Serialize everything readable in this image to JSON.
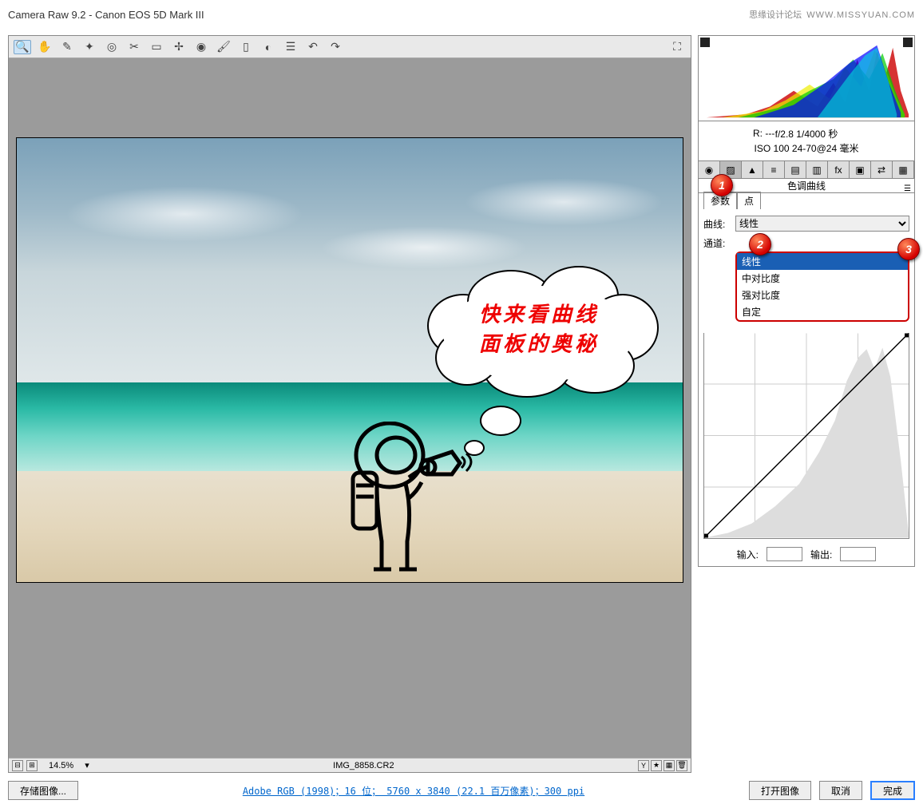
{
  "titlebar": {
    "app": "Camera Raw 9.2  -  Canon EOS 5D Mark III",
    "watermark_text": "思缘设计论坛",
    "watermark_url": "WWW.MISSYUAN.COM"
  },
  "toolbar": {
    "tools": [
      "zoom",
      "hand",
      "eyedropper",
      "sampler",
      "target",
      "crop",
      "straighten",
      "spot",
      "redeye",
      "brush",
      "grad",
      "radial",
      "prefs",
      "rotate-ccw",
      "rotate-cw"
    ],
    "fullscreen": "⛶"
  },
  "canvas": {
    "speech_line1": "快来看曲线",
    "speech_line2": "面板的奥秘"
  },
  "statusbar": {
    "zoom": "14.5%",
    "filename": "IMG_8858.CR2"
  },
  "exif": {
    "r_label": "R:  ---",
    "line1": "f/2.8    1/4000 秒",
    "line2": "ISO 100    24-70@24 毫米"
  },
  "panel": {
    "title": "色调曲线",
    "subtabs": {
      "parametric": "参数",
      "point": "点"
    },
    "curve_label": "曲线:",
    "curve_value": "线性",
    "channel_label": "通道:",
    "dropdown": [
      "线性",
      "中对比度",
      "强对比度",
      "自定"
    ],
    "input_label": "输入:",
    "output_label": "输出:"
  },
  "buttons": {
    "save": "存储图像...",
    "meta": "Adobe RGB (1998)；16 位；  5760 x 3840 (22.1 百万像素)；300 ppi",
    "open": "打开图像",
    "cancel": "取消",
    "done": "完成"
  },
  "callouts": {
    "c1": "1",
    "c2": "2",
    "c3": "3"
  }
}
